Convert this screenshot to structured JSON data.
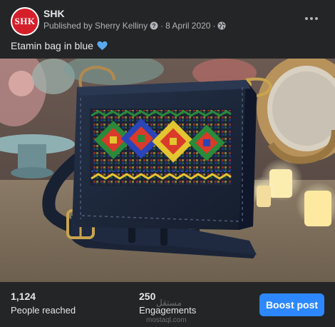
{
  "post": {
    "page_name": "SHK",
    "avatar_text": "SHK",
    "published_by": "Published by Sherry Kelliny",
    "date": "8 April 2020",
    "separator": "·",
    "caption": "Etamin bag in blue",
    "caption_emoji": "blue-heart-icon"
  },
  "stats": {
    "reached_value": "1,124",
    "reached_label": "People reached",
    "engagements_value": "250",
    "engagements_label": "Engagements"
  },
  "actions": {
    "boost_label": "Boost post",
    "more_icon": "more-horizontal-icon"
  },
  "watermark": {
    "line1": "مستقل",
    "line2": "mostaql.com"
  },
  "colors": {
    "background": "#242526",
    "text_primary": "#e4e6eb",
    "text_secondary": "#b0b3b8",
    "accent": "#2d88ff",
    "avatar_red": "#d41f2b",
    "heart_blue": "#5aa9f0"
  }
}
